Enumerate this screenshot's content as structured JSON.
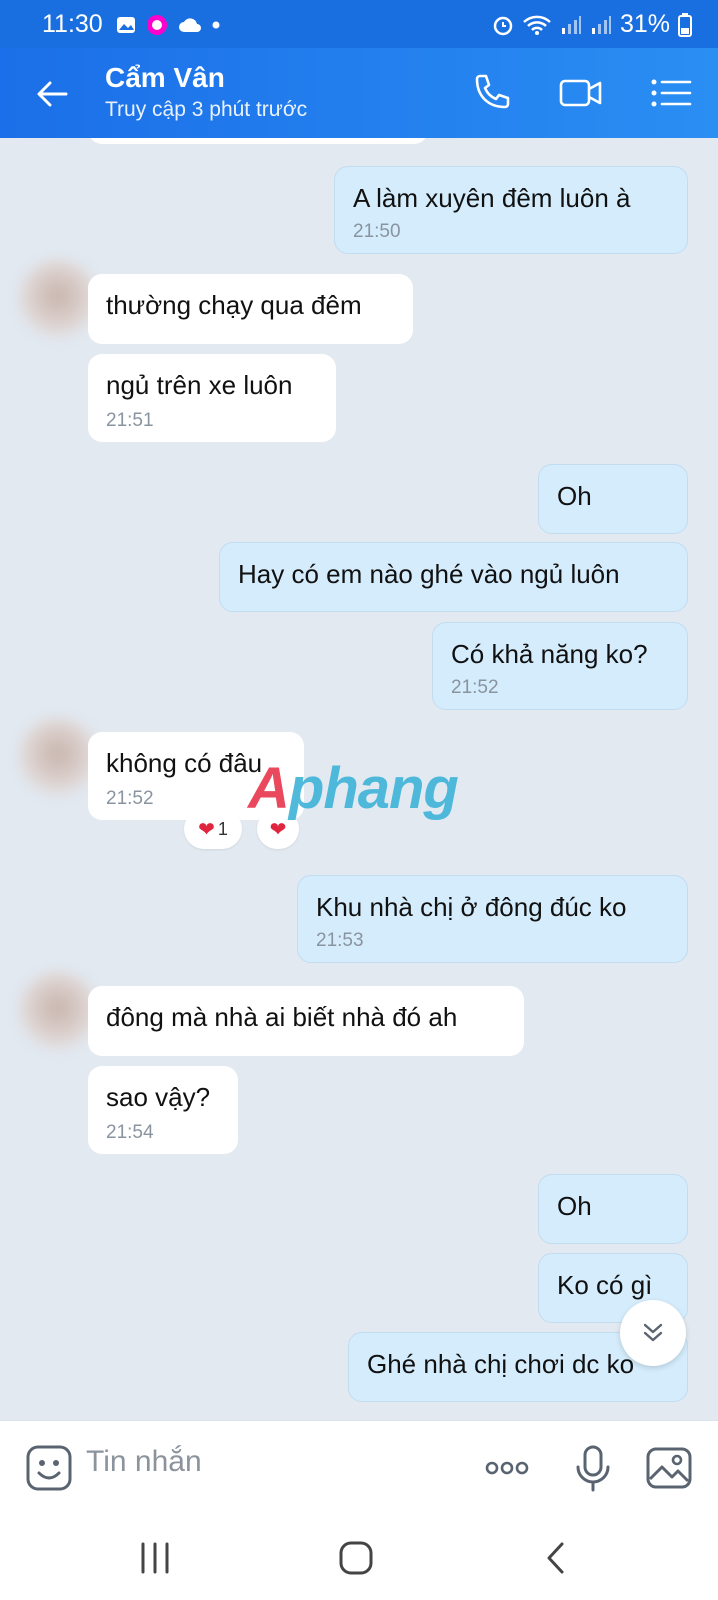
{
  "status_bar": {
    "time": "11:30",
    "battery": "31%"
  },
  "header": {
    "title": "Cẩm Vân",
    "subtitle": "Truy cập 3 phút trước"
  },
  "messages": [
    {
      "side": "out",
      "text": "A làm xuyên đêm luôn à",
      "time": "21:50"
    },
    {
      "side": "in",
      "text": "thường chạy qua đêm",
      "time": ""
    },
    {
      "side": "in",
      "text": "ngủ trên xe luôn",
      "time": "21:51"
    },
    {
      "side": "out",
      "text": "Oh",
      "time": ""
    },
    {
      "side": "out",
      "text": "Hay có em nào ghé vào ngủ luôn",
      "time": ""
    },
    {
      "side": "out",
      "text": "Có khả năng ko?",
      "time": "21:52"
    },
    {
      "side": "in",
      "text": "không có đâu",
      "time": "21:52",
      "reaction_count": "1"
    },
    {
      "side": "out",
      "text": "Khu nhà chị ở đông đúc ko",
      "time": "21:53"
    },
    {
      "side": "in",
      "text": "đông mà nhà ai biết nhà đó ah",
      "time": ""
    },
    {
      "side": "in",
      "text": "sao vậy?",
      "time": "21:54"
    },
    {
      "side": "out",
      "text": "Oh",
      "time": ""
    },
    {
      "side": "out",
      "text": "Ko có gì",
      "time": ""
    },
    {
      "side": "out",
      "text": "Ghé nhà chị chơi dc ko",
      "time": ""
    }
  ],
  "watermark": {
    "first": "A",
    "rest": "phang"
  },
  "input": {
    "placeholder": "Tin nhắn"
  },
  "colors": {
    "header": "#1b6fe8",
    "outgoing_bubble": "#d4ecfc",
    "incoming_bubble": "#ffffff",
    "chat_background": "#e2e9f1"
  },
  "icons": [
    "back-arrow-icon",
    "phone-icon",
    "video-call-icon",
    "menu-list-icon",
    "emoji-icon",
    "more-options-icon",
    "microphone-icon",
    "image-icon",
    "heart-icon",
    "scroll-down-icon"
  ]
}
